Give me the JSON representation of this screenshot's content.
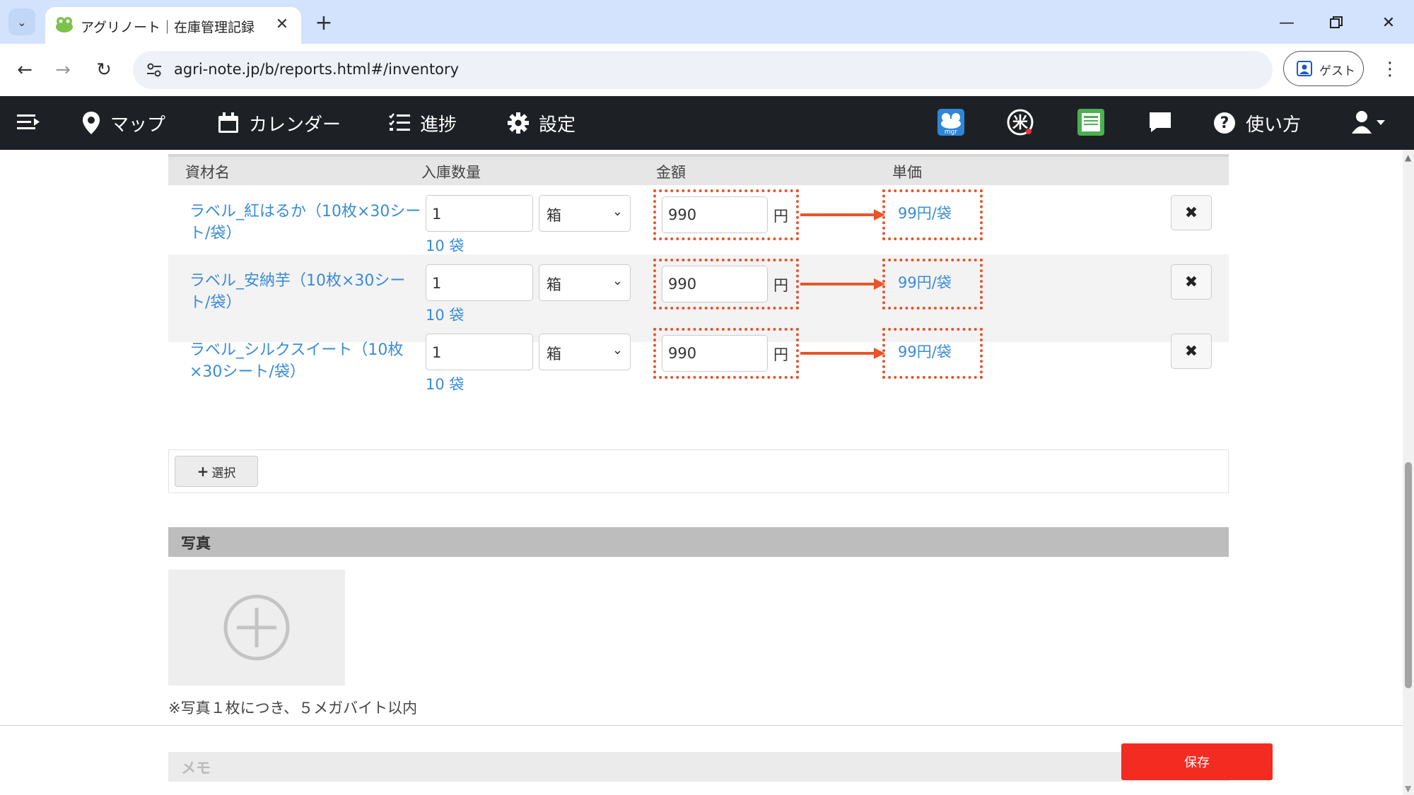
{
  "browser": {
    "tab_title": "アグリノート｜在庫管理記録",
    "url": "agri-note.jp/b/reports.html#/inventory",
    "profile_label": "ゲスト"
  },
  "app_nav": {
    "items": [
      {
        "label": "マップ"
      },
      {
        "label": "カレンダー"
      },
      {
        "label": "進捗"
      },
      {
        "label": "設定"
      }
    ],
    "help_label": "使い方",
    "icons": [
      "mgr-icon",
      "rice-icon",
      "book-icon",
      "chat-icon",
      "help-icon",
      "user-icon"
    ]
  },
  "table": {
    "headers": {
      "material": "資材名",
      "quantity": "入庫数量",
      "amount": "金額",
      "unit_price": "単価"
    },
    "rows": [
      {
        "name": "ラベル_紅はるか（10枚×30シート/袋）",
        "quantity": "1",
        "unit": "箱",
        "quantity_sub": "10 袋",
        "amount": "990",
        "currency": "円",
        "unit_price": "99円/袋"
      },
      {
        "name": "ラベル_安納芋（10枚×30シート/袋）",
        "quantity": "1",
        "unit": "箱",
        "quantity_sub": "10 袋",
        "amount": "990",
        "currency": "円",
        "unit_price": "99円/袋"
      },
      {
        "name": "ラベル_シルクスイート（10枚×30シート/袋）",
        "quantity": "1",
        "unit": "箱",
        "quantity_sub": "10 袋",
        "amount": "990",
        "currency": "円",
        "unit_price": "99円/袋"
      }
    ],
    "select_button": "選択"
  },
  "photo": {
    "heading": "写真",
    "note": "※写真１枚につき、５メガバイト以内"
  },
  "memo": {
    "heading": "メモ"
  },
  "save_button": "保存",
  "colors": {
    "nav_bg": "#1d2125",
    "link": "#3a8bd8",
    "highlight": "#e8542a",
    "save": "#f42b21"
  }
}
